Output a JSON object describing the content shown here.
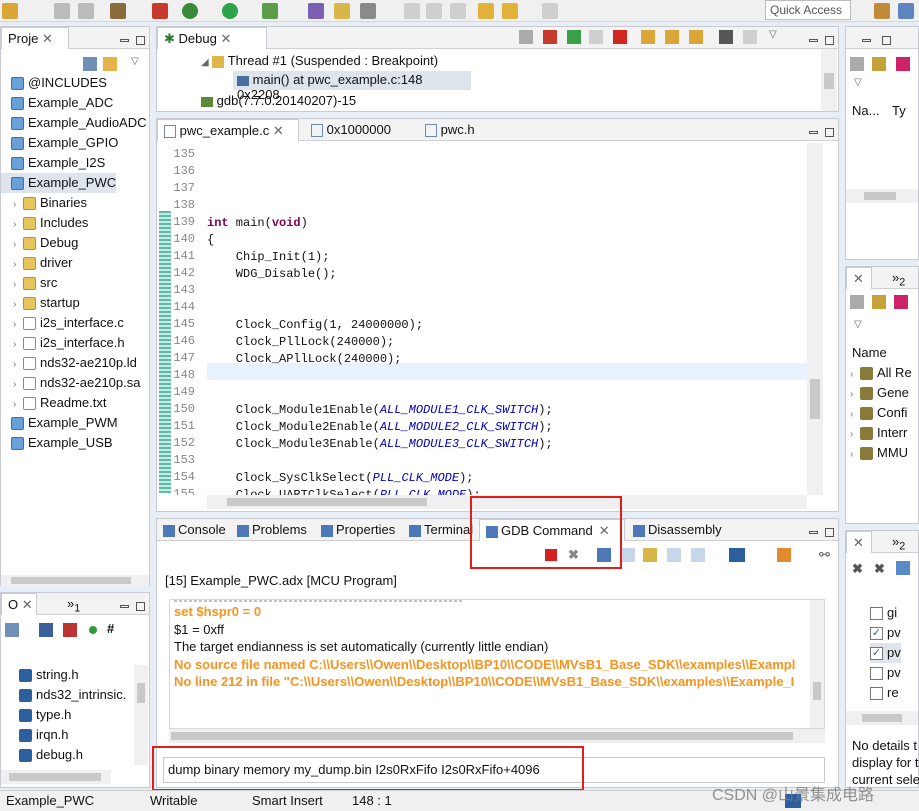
{
  "toolbar": {
    "quick_access": "Quick Access"
  },
  "project_panel": {
    "tab": "Proje",
    "items": [
      {
        "label": "@INCLUDES",
        "indent": 0
      },
      {
        "label": "Example_ADC",
        "indent": 0
      },
      {
        "label": "Example_AudioADC",
        "indent": 0
      },
      {
        "label": "Example_GPIO",
        "indent": 0
      },
      {
        "label": "Example_I2S",
        "indent": 0
      },
      {
        "label": "Example_PWC",
        "indent": 0
      },
      {
        "label": "Binaries",
        "indent": 1
      },
      {
        "label": "Includes",
        "indent": 1
      },
      {
        "label": "Debug",
        "indent": 1
      },
      {
        "label": "driver",
        "indent": 1
      },
      {
        "label": "src",
        "indent": 1
      },
      {
        "label": "startup",
        "indent": 1
      },
      {
        "label": "i2s_interface.c",
        "indent": 1
      },
      {
        "label": "i2s_interface.h",
        "indent": 1
      },
      {
        "label": "nds32-ae210p.ld",
        "indent": 1
      },
      {
        "label": "nds32-ae210p.sa",
        "indent": 1
      },
      {
        "label": "Readme.txt",
        "indent": 1
      },
      {
        "label": "Example_PWM",
        "indent": 0
      },
      {
        "label": "Example_USB",
        "indent": 0
      }
    ]
  },
  "outline_panel": {
    "tab": "O",
    "tab2": "1",
    "items": [
      "string.h",
      "nds32_intrinsic.",
      "type.h",
      "irqn.h",
      "debug.h"
    ]
  },
  "debug_panel": {
    "tab": "Debug",
    "thread": "Thread #1 (Suspended : Breakpoint)",
    "frame": "main() at pwc_example.c:148 0x2208",
    "gdb": "gdb(7.7.0.20140207)-15"
  },
  "editor": {
    "tabs": [
      "pwc_example.c",
      "0x1000000",
      "pwc.h"
    ],
    "lines": [
      {
        "n": "135",
        "code": ""
      },
      {
        "n": "136",
        "code": ""
      },
      {
        "n": "137",
        "code": ""
      },
      {
        "n": "138",
        "code": ""
      },
      {
        "n": "139",
        "code": "int main(void)"
      },
      {
        "n": "140",
        "code": "{"
      },
      {
        "n": "141",
        "code": "    Chip_Init(1);"
      },
      {
        "n": "142",
        "code": "    WDG_Disable();"
      },
      {
        "n": "143",
        "code": ""
      },
      {
        "n": "144",
        "code": ""
      },
      {
        "n": "145",
        "code": "    Clock_Config(1, 24000000);"
      },
      {
        "n": "146",
        "code": "    Clock_PllLock(240000);"
      },
      {
        "n": "147",
        "code": "    Clock_APllLock(240000);"
      },
      {
        "n": "148",
        "code": ""
      },
      {
        "n": "149",
        "code": ""
      },
      {
        "n": "150",
        "code": "    Clock_Module1Enable(ALL_MODULE1_CLK_SWITCH);"
      },
      {
        "n": "151",
        "code": "    Clock_Module2Enable(ALL_MODULE2_CLK_SWITCH);"
      },
      {
        "n": "152",
        "code": "    Clock_Module3Enable(ALL_MODULE3_CLK_SWITCH);"
      },
      {
        "n": "153",
        "code": ""
      },
      {
        "n": "154",
        "code": "    Clock_SysClkSelect(PLL_CLK_MODE);"
      },
      {
        "n": "155",
        "code": "    Clock_UARTClkSelect(PLL_CLK_MODE);"
      }
    ]
  },
  "bottom_tabs": [
    "Console",
    "Problems",
    "Properties",
    "Terminal",
    "GDB Command",
    "Disassembly"
  ],
  "console": {
    "header": "[15] Example_PWC.adx [MCU Program]",
    "lines": [
      {
        "text": "set $hspr0 = 0",
        "style": "orange"
      },
      {
        "text": "$1 = 0xff",
        "style": "normal"
      },
      {
        "text": "The target endianness is set automatically (currently little endian)",
        "style": "normal"
      },
      {
        "text": "No source file named C:\\\\Users\\\\Owen\\\\Desktop\\\\BP10\\\\CODE\\\\MVsB1_Base_SDK\\\\examples\\\\Exampl",
        "style": "orange"
      },
      {
        "text": "No line 212 in file \"C:\\\\Users\\\\Owen\\\\Desktop\\\\BP10\\\\CODE\\\\MVsB1_Base_SDK\\\\examples\\\\Example_I",
        "style": "orange"
      }
    ],
    "command": "dump binary memory my_dump.bin I2s0RxFifo I2s0RxFifo+4096"
  },
  "right_top": {
    "col1": "Na...",
    "col2": "Ty"
  },
  "right_mid": {
    "tab2": "2",
    "header": "Name",
    "items": [
      "All Re",
      "Gene",
      "Confi",
      "Interr",
      "MMU"
    ]
  },
  "right_bottom": {
    "tab2": "2",
    "items": [
      {
        "label": "gi",
        "checked": false
      },
      {
        "label": "pv",
        "checked": true
      },
      {
        "label": "pv",
        "checked": true
      },
      {
        "label": "pv",
        "checked": false
      },
      {
        "label": "re",
        "checked": false
      }
    ],
    "details": [
      "No details t",
      "display for t",
      "current sele"
    ]
  },
  "status": {
    "project": "Example_PWC",
    "mode": "Writable",
    "insert": "Smart Insert",
    "pos": "148 : 1"
  },
  "watermark": "CSDN @山景集成电路"
}
